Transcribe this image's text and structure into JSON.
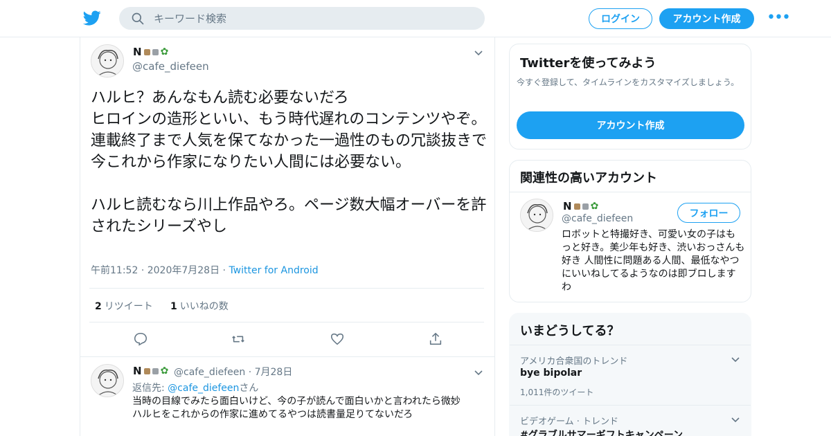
{
  "colors": {
    "accent": "#1da1f2",
    "link": "#1b95e0",
    "muted": "#657786",
    "border": "#e6ecf0"
  },
  "header": {
    "search_placeholder": "キーワード検索",
    "login_label": "ログイン",
    "signup_label": "アカウント作成",
    "more_label": "•••"
  },
  "tweet": {
    "name": "N",
    "handle": "@cafe_diefeen",
    "text": "ハルヒ？あんなもん読む必要ないだろ\nヒロインの造形といい、もう時代遅れのコンテンツやぞ。連載終了まで人気を保てなかった一過性のもの冗談抜きで今これから作家になりたい人間には必要ない。\n\nハルヒ読むなら川上作品やろ。ページ数大幅オーバーを許されたシリーズやし",
    "time": "午前11:52",
    "date": "2020年7月28日",
    "source": "Twitter for Android",
    "retweets_count": "2",
    "retweets_label": "リツイート",
    "likes_count": "1",
    "likes_label": "いいねの数"
  },
  "reply": {
    "name": "N",
    "handle": "@cafe_diefeen",
    "date": "7月28日",
    "replyto_prefix": "返信先: ",
    "replyto_handle": "@cafe_diefeen",
    "replyto_suffix": "さん",
    "text": "当時の目線でみたら面白いけど、今の子が読んで面白いかと言われたら微妙\nハルヒをこれからの作家に進めてるやつは読書量足りてないだろ"
  },
  "sidebar": {
    "try": {
      "title": "Twitterを使ってみよう",
      "subtitle": "今すぐ登録して、タイムラインをカスタマイズしましょう。",
      "button": "アカウント作成"
    },
    "related": {
      "title": "関連性の高いアカウント",
      "name": "N",
      "handle": "@cafe_diefeen",
      "follow_label": "フォロー",
      "bio": "ロボットと特撮好き、可愛い女の子はもっと好き。美少年も好き、渋いおっさんも好き 人間性に問題ある人間、最低なやつにいいねしてるようなのは即ブロしますわ"
    },
    "trends": {
      "title": "いまどうしてる？",
      "items": [
        {
          "context": "アメリカ合衆国のトレンド",
          "name": "bye bipolar",
          "count": "1,011件のツイート"
        },
        {
          "context": "ビデオゲーム · トレンド",
          "name": "#グラブルサマーギフトキャンペーン",
          "count": ""
        }
      ]
    }
  }
}
